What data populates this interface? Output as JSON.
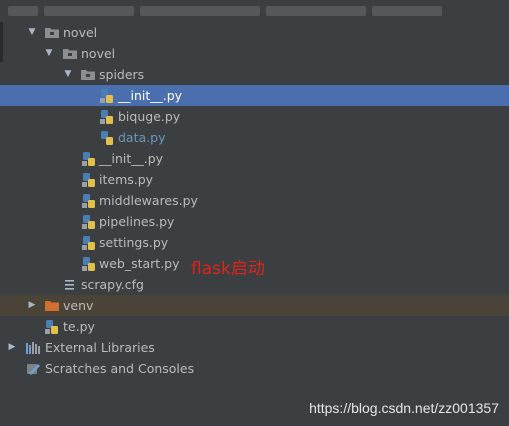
{
  "project_tree": {
    "items": [
      {
        "label": "novel",
        "type": "folder"
      },
      {
        "label": "novel",
        "type": "package"
      },
      {
        "label": "spiders",
        "type": "package"
      },
      {
        "label": "__init__.py",
        "type": "python"
      },
      {
        "label": "biquge.py",
        "type": "python"
      },
      {
        "label": "data.py",
        "type": "python"
      },
      {
        "label": "__init__.py",
        "type": "python"
      },
      {
        "label": "items.py",
        "type": "python"
      },
      {
        "label": "middlewares.py",
        "type": "python"
      },
      {
        "label": "pipelines.py",
        "type": "python"
      },
      {
        "label": "settings.py",
        "type": "python"
      },
      {
        "label": "web_start.py",
        "type": "python"
      },
      {
        "label": "scrapy.cfg",
        "type": "config"
      },
      {
        "label": "venv",
        "type": "excluded-folder"
      },
      {
        "label": "te.py",
        "type": "python"
      },
      {
        "label": "External Libraries",
        "type": "libraries"
      },
      {
        "label": "Scratches and Consoles",
        "type": "scratches"
      }
    ]
  },
  "annotation": {
    "text": "flask启动"
  },
  "watermark": {
    "text": "https://blog.csdn.net/zz001357"
  },
  "colors": {
    "background": "#3c3f41",
    "selection": "#4b6eaf",
    "excluded_folder": "#4a4438",
    "annotation": "#e0221b",
    "modified_file": "#6897bb"
  }
}
